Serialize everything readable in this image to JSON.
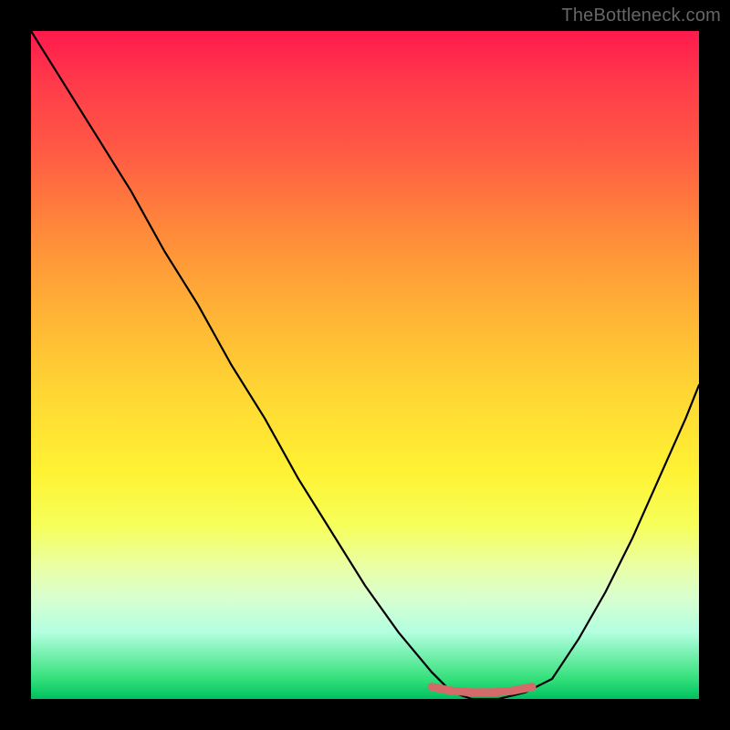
{
  "watermark": "TheBottleneck.com",
  "chart_data": {
    "type": "line",
    "title": "",
    "xlabel": "",
    "ylabel": "",
    "xlim": [
      0,
      100
    ],
    "ylim": [
      0,
      100
    ],
    "grid": false,
    "legend": false,
    "background_gradient": {
      "top": "#ff1a4d",
      "mid": "#ffd633",
      "bottom": "#00c060",
      "meaning": "red = high bottleneck, green = low bottleneck"
    },
    "series": [
      {
        "name": "bottleneck-curve",
        "x": [
          0,
          5,
          10,
          15,
          20,
          25,
          30,
          35,
          40,
          45,
          50,
          55,
          60,
          63,
          66,
          70,
          74,
          78,
          82,
          86,
          90,
          94,
          98,
          100
        ],
        "y": [
          100,
          92,
          84,
          76,
          67,
          59,
          50,
          42,
          33,
          25,
          17,
          10,
          4,
          1,
          0,
          0,
          1,
          3,
          9,
          16,
          24,
          33,
          42,
          47
        ]
      },
      {
        "name": "valley-marker",
        "x": [
          60,
          63,
          66,
          69,
          72,
          75
        ],
        "y": [
          1.8,
          1.2,
          1.0,
          1.0,
          1.2,
          1.8
        ]
      }
    ],
    "valley_marker_color": "#d56a6a",
    "curve_color": "#000000"
  }
}
